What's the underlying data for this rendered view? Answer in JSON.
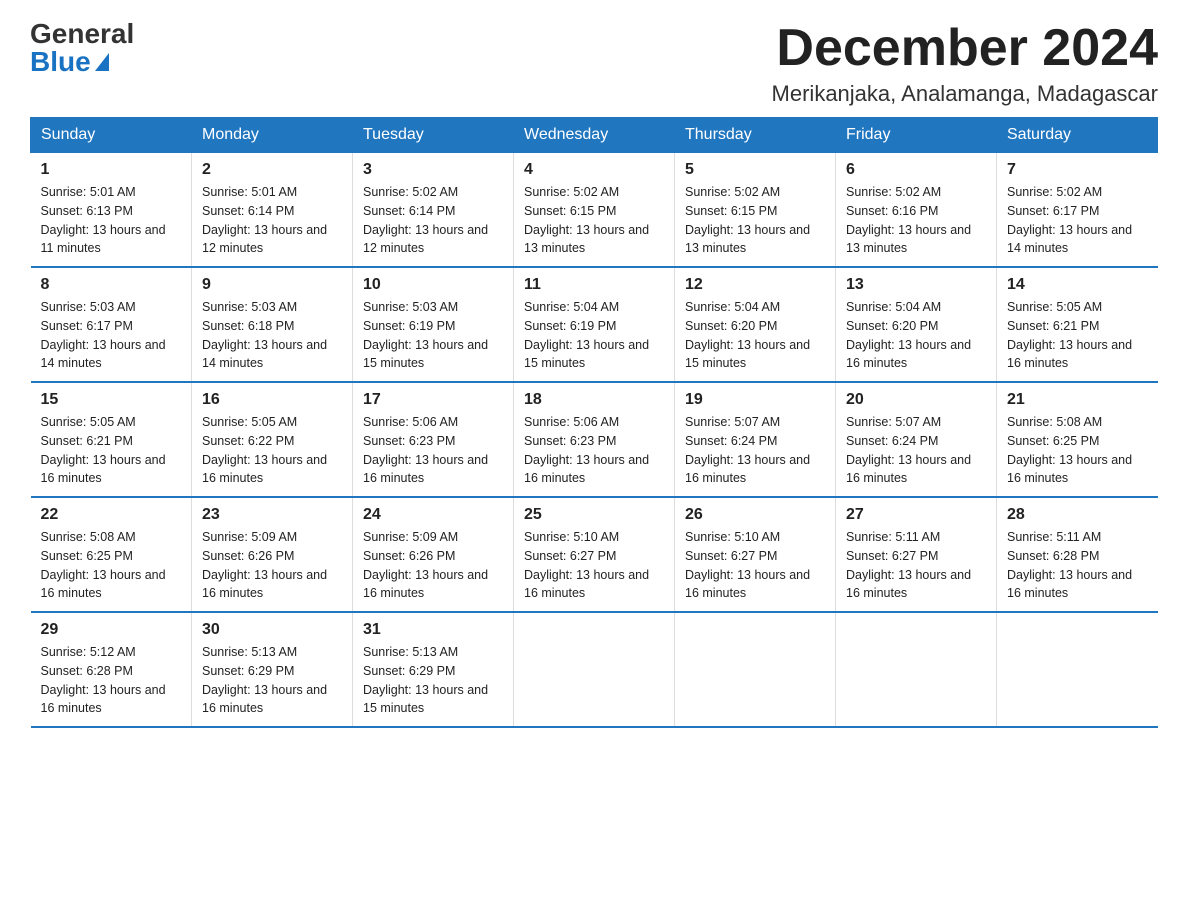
{
  "logo": {
    "general": "General",
    "blue": "Blue"
  },
  "title": "December 2024",
  "location": "Merikanjaka, Analamanga, Madagascar",
  "days_of_week": [
    "Sunday",
    "Monday",
    "Tuesday",
    "Wednesday",
    "Thursday",
    "Friday",
    "Saturday"
  ],
  "weeks": [
    [
      {
        "day": "1",
        "sunrise": "5:01 AM",
        "sunset": "6:13 PM",
        "daylight": "13 hours and 11 minutes."
      },
      {
        "day": "2",
        "sunrise": "5:01 AM",
        "sunset": "6:14 PM",
        "daylight": "13 hours and 12 minutes."
      },
      {
        "day": "3",
        "sunrise": "5:02 AM",
        "sunset": "6:14 PM",
        "daylight": "13 hours and 12 minutes."
      },
      {
        "day": "4",
        "sunrise": "5:02 AM",
        "sunset": "6:15 PM",
        "daylight": "13 hours and 13 minutes."
      },
      {
        "day": "5",
        "sunrise": "5:02 AM",
        "sunset": "6:15 PM",
        "daylight": "13 hours and 13 minutes."
      },
      {
        "day": "6",
        "sunrise": "5:02 AM",
        "sunset": "6:16 PM",
        "daylight": "13 hours and 13 minutes."
      },
      {
        "day": "7",
        "sunrise": "5:02 AM",
        "sunset": "6:17 PM",
        "daylight": "13 hours and 14 minutes."
      }
    ],
    [
      {
        "day": "8",
        "sunrise": "5:03 AM",
        "sunset": "6:17 PM",
        "daylight": "13 hours and 14 minutes."
      },
      {
        "day": "9",
        "sunrise": "5:03 AM",
        "sunset": "6:18 PM",
        "daylight": "13 hours and 14 minutes."
      },
      {
        "day": "10",
        "sunrise": "5:03 AM",
        "sunset": "6:19 PM",
        "daylight": "13 hours and 15 minutes."
      },
      {
        "day": "11",
        "sunrise": "5:04 AM",
        "sunset": "6:19 PM",
        "daylight": "13 hours and 15 minutes."
      },
      {
        "day": "12",
        "sunrise": "5:04 AM",
        "sunset": "6:20 PM",
        "daylight": "13 hours and 15 minutes."
      },
      {
        "day": "13",
        "sunrise": "5:04 AM",
        "sunset": "6:20 PM",
        "daylight": "13 hours and 16 minutes."
      },
      {
        "day": "14",
        "sunrise": "5:05 AM",
        "sunset": "6:21 PM",
        "daylight": "13 hours and 16 minutes."
      }
    ],
    [
      {
        "day": "15",
        "sunrise": "5:05 AM",
        "sunset": "6:21 PM",
        "daylight": "13 hours and 16 minutes."
      },
      {
        "day": "16",
        "sunrise": "5:05 AM",
        "sunset": "6:22 PM",
        "daylight": "13 hours and 16 minutes."
      },
      {
        "day": "17",
        "sunrise": "5:06 AM",
        "sunset": "6:23 PM",
        "daylight": "13 hours and 16 minutes."
      },
      {
        "day": "18",
        "sunrise": "5:06 AM",
        "sunset": "6:23 PM",
        "daylight": "13 hours and 16 minutes."
      },
      {
        "day": "19",
        "sunrise": "5:07 AM",
        "sunset": "6:24 PM",
        "daylight": "13 hours and 16 minutes."
      },
      {
        "day": "20",
        "sunrise": "5:07 AM",
        "sunset": "6:24 PM",
        "daylight": "13 hours and 16 minutes."
      },
      {
        "day": "21",
        "sunrise": "5:08 AM",
        "sunset": "6:25 PM",
        "daylight": "13 hours and 16 minutes."
      }
    ],
    [
      {
        "day": "22",
        "sunrise": "5:08 AM",
        "sunset": "6:25 PM",
        "daylight": "13 hours and 16 minutes."
      },
      {
        "day": "23",
        "sunrise": "5:09 AM",
        "sunset": "6:26 PM",
        "daylight": "13 hours and 16 minutes."
      },
      {
        "day": "24",
        "sunrise": "5:09 AM",
        "sunset": "6:26 PM",
        "daylight": "13 hours and 16 minutes."
      },
      {
        "day": "25",
        "sunrise": "5:10 AM",
        "sunset": "6:27 PM",
        "daylight": "13 hours and 16 minutes."
      },
      {
        "day": "26",
        "sunrise": "5:10 AM",
        "sunset": "6:27 PM",
        "daylight": "13 hours and 16 minutes."
      },
      {
        "day": "27",
        "sunrise": "5:11 AM",
        "sunset": "6:27 PM",
        "daylight": "13 hours and 16 minutes."
      },
      {
        "day": "28",
        "sunrise": "5:11 AM",
        "sunset": "6:28 PM",
        "daylight": "13 hours and 16 minutes."
      }
    ],
    [
      {
        "day": "29",
        "sunrise": "5:12 AM",
        "sunset": "6:28 PM",
        "daylight": "13 hours and 16 minutes."
      },
      {
        "day": "30",
        "sunrise": "5:13 AM",
        "sunset": "6:29 PM",
        "daylight": "13 hours and 16 minutes."
      },
      {
        "day": "31",
        "sunrise": "5:13 AM",
        "sunset": "6:29 PM",
        "daylight": "13 hours and 15 minutes."
      },
      null,
      null,
      null,
      null
    ]
  ],
  "sunrise_label": "Sunrise:",
  "sunset_label": "Sunset:",
  "daylight_label": "Daylight:"
}
